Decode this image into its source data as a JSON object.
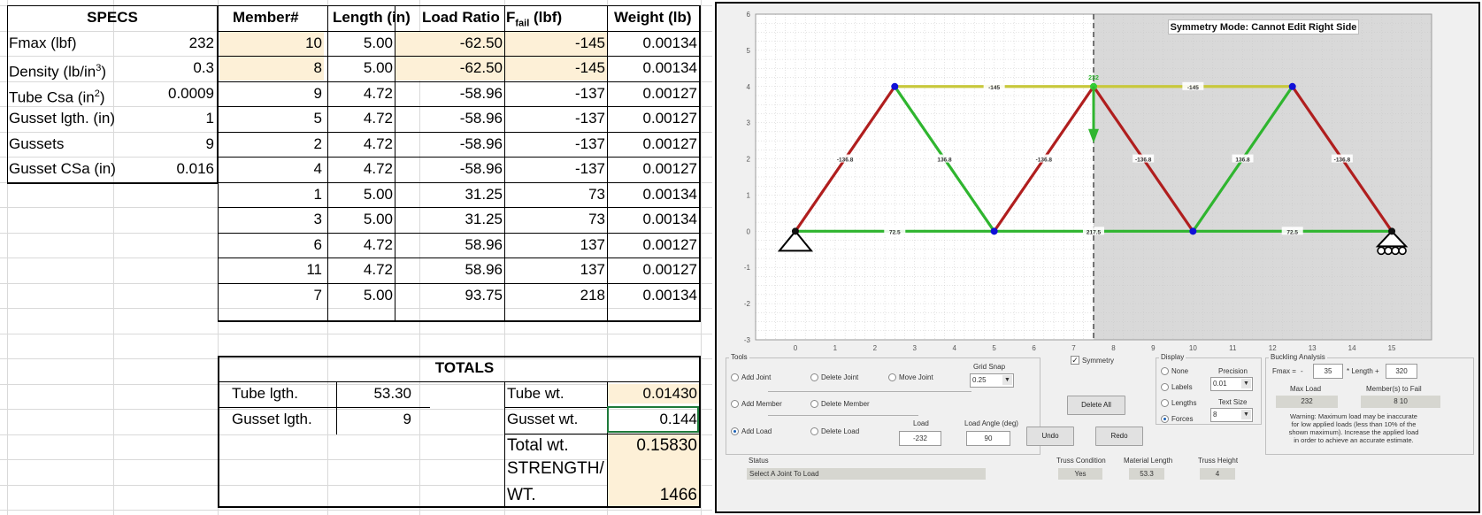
{
  "specs": {
    "header": "SPECS",
    "rows": [
      {
        "label": "Fmax (lbf)",
        "value": "232"
      },
      {
        "label": "Density (lb/in",
        "sup": "3",
        "tail": ")",
        "value": "0.3"
      },
      {
        "label": "Tube Csa (in",
        "sup": "2",
        "tail": ")",
        "value": "0.0009"
      },
      {
        "label": "Gusset lgth. (in)",
        "value": "1"
      },
      {
        "label": "Gussets",
        "value": "9"
      },
      {
        "label": "Gusset CSa (in)",
        "value": "0.016"
      }
    ]
  },
  "members": {
    "headers": {
      "member": "Member#",
      "length": "Length (in)",
      "ratio": "Load Ratio",
      "ffail_main": "F",
      "ffail_sub": "fail",
      "ffail_tail": " (lbf)",
      "weight": "Weight (lb)"
    },
    "rows": [
      {
        "id": "10",
        "length": "5.00",
        "ratio": "-62.50",
        "ffail": "-145",
        "weight": "0.00134",
        "highlight": true
      },
      {
        "id": "8",
        "length": "5.00",
        "ratio": "-62.50",
        "ffail": "-145",
        "weight": "0.00134",
        "highlight": true
      },
      {
        "id": "9",
        "length": "4.72",
        "ratio": "-58.96",
        "ffail": "-137",
        "weight": "0.00127",
        "highlight": false
      },
      {
        "id": "5",
        "length": "4.72",
        "ratio": "-58.96",
        "ffail": "-137",
        "weight": "0.00127",
        "highlight": false
      },
      {
        "id": "2",
        "length": "4.72",
        "ratio": "-58.96",
        "ffail": "-137",
        "weight": "0.00127",
        "highlight": false
      },
      {
        "id": "4",
        "length": "4.72",
        "ratio": "-58.96",
        "ffail": "-137",
        "weight": "0.00127",
        "highlight": false
      },
      {
        "id": "1",
        "length": "5.00",
        "ratio": "31.25",
        "ffail": "73",
        "weight": "0.00134",
        "highlight": false
      },
      {
        "id": "3",
        "length": "5.00",
        "ratio": "31.25",
        "ffail": "73",
        "weight": "0.00134",
        "highlight": false
      },
      {
        "id": "6",
        "length": "4.72",
        "ratio": "58.96",
        "ffail": "137",
        "weight": "0.00127",
        "highlight": false
      },
      {
        "id": "11",
        "length": "4.72",
        "ratio": "58.96",
        "ffail": "137",
        "weight": "0.00127",
        "highlight": false
      },
      {
        "id": "7",
        "length": "5.00",
        "ratio": "93.75",
        "ffail": "218",
        "weight": "0.00134",
        "highlight": false
      }
    ]
  },
  "totals": {
    "header": "TOTALS",
    "tube_lgth_label": "Tube lgth.",
    "tube_lgth": "53.30",
    "gusset_lgth_label": "Gusset lgth.",
    "gusset_lgth": "9",
    "tube_wt_label": "Tube wt.",
    "tube_wt": "0.01430",
    "gusset_wt_label": "Gusset wt.",
    "gusset_wt": "0.144",
    "total_wt_label": "Total wt.",
    "total_wt": "0.15830",
    "strength_label_1": "STRENGTH/",
    "strength_label_2": "WT.",
    "strength": "1466"
  },
  "colors": {
    "compression": "#b01e1e",
    "tension": "#2fb52f",
    "zero_or_top": "#c8c83c",
    "joint": "#1010d8",
    "load_arrow": "#2fb52f",
    "highlight_fill": "#fdf0d7",
    "right_shade": "#d9d9d9"
  },
  "app": {
    "banner": "Symmetry Mode: Cannot Edit Right Side",
    "axes": {
      "x_ticks": [
        "0",
        "1",
        "2",
        "3",
        "4",
        "5",
        "6",
        "7",
        "8",
        "9",
        "10",
        "11",
        "12",
        "13",
        "14",
        "15"
      ],
      "y_ticks": [
        "6",
        "5",
        "4",
        "3",
        "2",
        "1",
        "0",
        "-1",
        "-2",
        "-3"
      ],
      "xlim": [
        -1,
        16
      ],
      "ylim": [
        -3,
        6
      ],
      "symmetry_x": 7.5
    },
    "joints": [
      {
        "x": 0,
        "y": 0,
        "kind": "pin"
      },
      {
        "x": 2.5,
        "y": 4,
        "kind": "blue"
      },
      {
        "x": 5,
        "y": 0,
        "kind": "blue"
      },
      {
        "x": 7.5,
        "y": 4,
        "kind": "green"
      },
      {
        "x": 10,
        "y": 0,
        "kind": "blue"
      },
      {
        "x": 12.5,
        "y": 4,
        "kind": "blue"
      },
      {
        "x": 15,
        "y": 0,
        "kind": "roller"
      }
    ],
    "members": [
      {
        "a": 0,
        "b": 1,
        "type": "compression",
        "force": "-136.8"
      },
      {
        "a": 1,
        "b": 2,
        "type": "tension",
        "force": "136.8"
      },
      {
        "a": 2,
        "b": 3,
        "type": "compression",
        "force": "-136.8"
      },
      {
        "a": 3,
        "b": 4,
        "type": "compression",
        "force": "-136.8"
      },
      {
        "a": 4,
        "b": 5,
        "type": "tension",
        "force": "136.8"
      },
      {
        "a": 5,
        "b": 6,
        "type": "compression",
        "force": "-136.8"
      },
      {
        "a": 1,
        "b": 3,
        "type": "zero_or_top",
        "force": "-145"
      },
      {
        "a": 3,
        "b": 5,
        "type": "zero_or_top",
        "force": "-145"
      },
      {
        "a": 0,
        "b": 2,
        "type": "tension",
        "force": "72.5"
      },
      {
        "a": 2,
        "b": 4,
        "type": "tension",
        "force": "217.5"
      },
      {
        "a": 4,
        "b": 6,
        "type": "tension",
        "force": "72.5"
      }
    ],
    "load_label": "232",
    "tools": {
      "title": "Tools",
      "add_joint": "Add Joint",
      "delete_joint": "Delete Joint",
      "move_joint": "Move Joint",
      "grid_snap_label": "Grid Snap",
      "grid_snap_value": "0.25",
      "add_member": "Add Member",
      "delete_member": "Delete Member",
      "add_load": "Add Load",
      "delete_load": "Delete Load",
      "load_label": "Load",
      "load_value": "-232",
      "load_angle_label": "Load Angle (deg)",
      "load_angle_value": "90"
    },
    "symmetry_label": "Symmetry",
    "delete_all": "Delete All",
    "undo": "Undo",
    "redo": "Redo",
    "display": {
      "title": "Display",
      "none": "None",
      "labels": "Labels",
      "lengths": "Lengths",
      "forces": "Forces",
      "precision_label": "Precision",
      "precision_value": "0.01",
      "text_size_label": "Text Size",
      "text_size_value": "8"
    },
    "buckling": {
      "title": "Buckling Analysis",
      "fmax_label": "Fmax =",
      "dash": "-",
      "coef": "35",
      "length_label": "* Length +",
      "const": "320",
      "max_load_label": "Max Load",
      "max_load_value": "232",
      "members_fail_label": "Member(s) to Fail",
      "members_fail_value": "8 10",
      "warning": "Warning: Maximum load may be inaccurate\nfor low applied loads (less than 10% of the\nshown maximum). Increase the applied load\nin order to achieve an accurate estimate."
    },
    "status": {
      "label": "Status",
      "value": "Select A Joint To Load"
    },
    "truss_condition": {
      "label": "Truss Condition",
      "value": "Yes"
    },
    "material_length": {
      "label": "Material Length",
      "value": "53.3"
    },
    "truss_height": {
      "label": "Truss Height",
      "value": "4"
    }
  }
}
